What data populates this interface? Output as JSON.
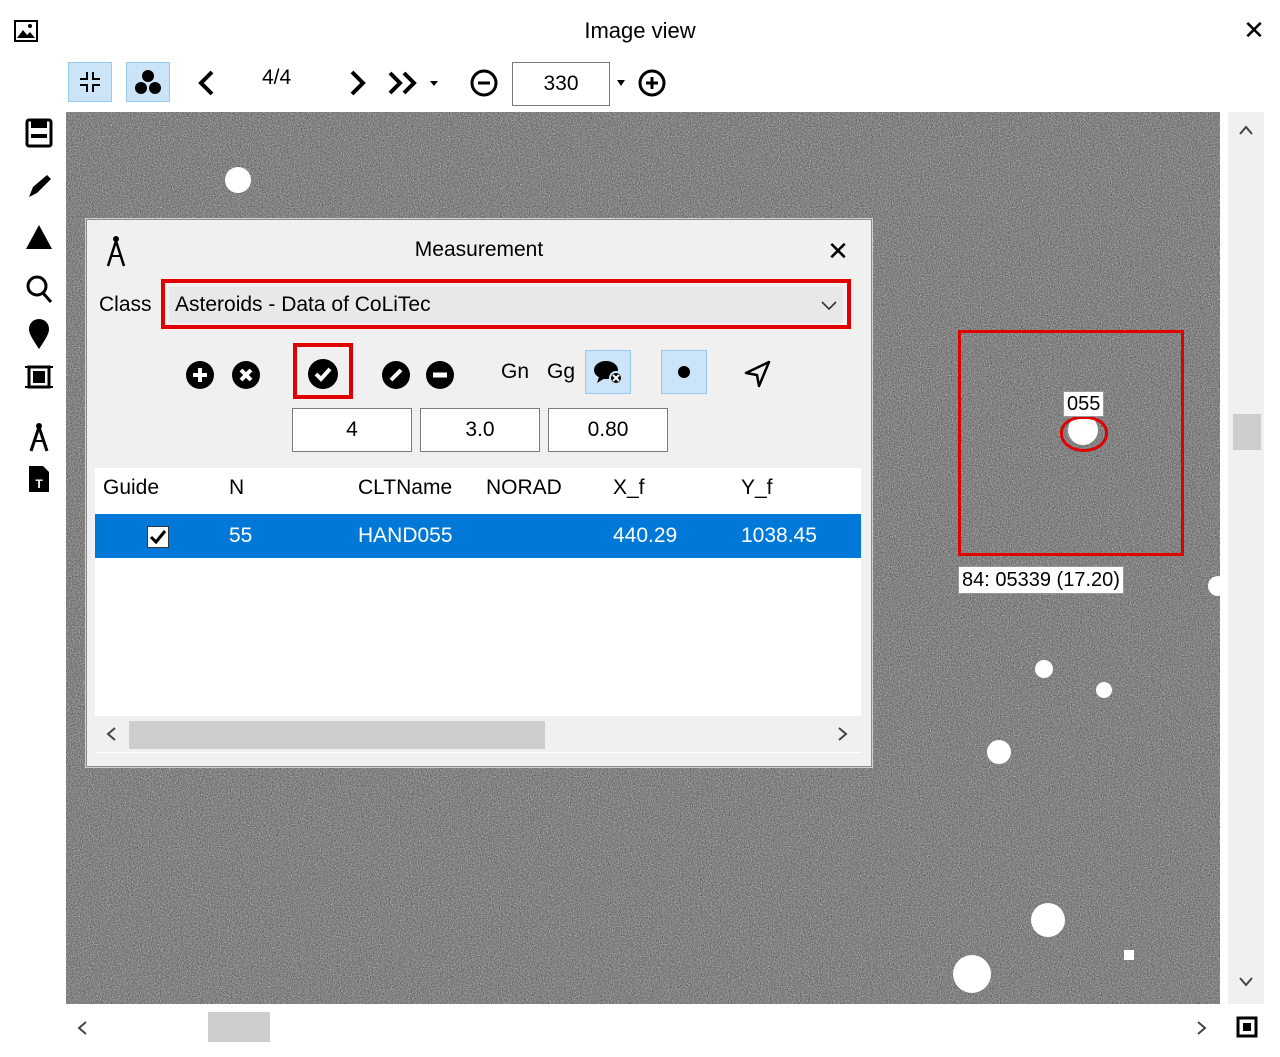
{
  "window": {
    "title": "Image view",
    "close_glyph": "✕"
  },
  "toolbar": {
    "frame_counter": "4/4",
    "zoom_value": "330"
  },
  "overlay": {
    "target_label": "055",
    "target_caption": "84: 05339 (17.20)"
  },
  "measurement": {
    "title": "Measurement",
    "close_glyph": "✕",
    "class_label": "Class",
    "class_value": "Asteroids - Data of CoLiTec",
    "gn_label": "Gn",
    "gg_label": "Gg",
    "fields": [
      "4",
      "3.0",
      "0.80"
    ],
    "columns": [
      "Guide",
      "N",
      "CLTName",
      "NORAD",
      "X_f",
      "Y_f"
    ],
    "rows": [
      {
        "guide_checked": true,
        "n": "55",
        "cltname": "HAND055",
        "norad": "",
        "x_f": "440.29",
        "y_f": "1038.45"
      }
    ]
  },
  "colors": {
    "highlight": "#e00000",
    "selection": "#0078d7",
    "toggle_active": "#cce4f7"
  },
  "icons": {
    "toolbar": [
      "collapse-icon",
      "cluster-icon",
      "prev-icon",
      "next-icon",
      "fast-forward-icon",
      "zoom-out-icon",
      "zoom-in-icon"
    ],
    "left": [
      "save-icon",
      "pencil-icon",
      "triangle-icon",
      "search-icon",
      "pin-icon",
      "frame-icon",
      "compass-icon",
      "text-file-icon"
    ],
    "dialog": [
      "add-icon",
      "remove-icon",
      "accept-icon",
      "edit-icon",
      "minus-icon",
      "comment-off-icon",
      "dot-icon",
      "navigate-icon"
    ]
  }
}
